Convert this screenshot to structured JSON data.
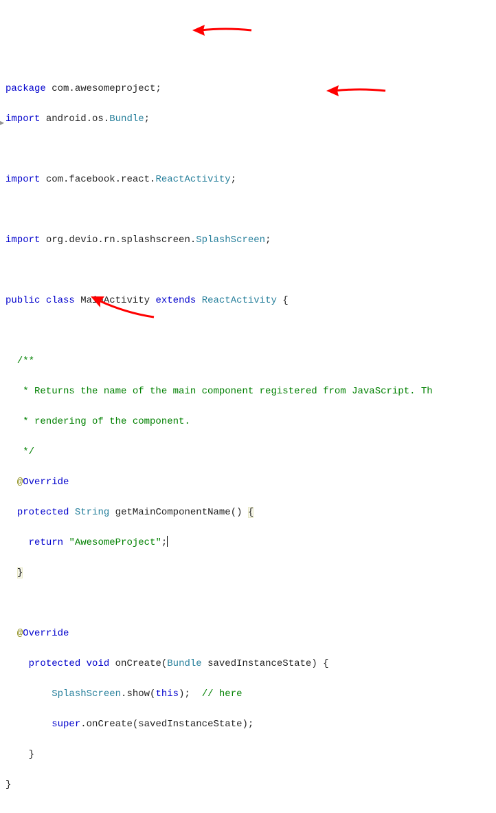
{
  "code": {
    "pkg_kw": "package",
    "pkg_val": " com.awesomeproject;",
    "imp1_kw": "import",
    "imp1_val": " android.os.",
    "imp1_type": "Bundle",
    "imp1_end": ";",
    "imp2_kw": "import",
    "imp2_val": " com.facebook.react.",
    "imp2_type": "ReactActivity",
    "imp2_end": ";",
    "imp3_kw": "import",
    "imp3_val": " org.devio.rn.splashscreen.",
    "imp3_type": "SplashScreen",
    "imp3_end": ";",
    "cls_public": "public",
    "cls_class": "class",
    "cls_name": " MainActivity ",
    "cls_extends": "extends",
    "cls_super": "ReactActivity",
    "cls_open": " {",
    "doc1": "  /**",
    "doc2": "   * Returns the name of the main component registered from JavaScript. Th",
    "doc3": "   * rendering of the component.",
    "doc4": "   */",
    "ovr1_at": "@",
    "ovr1_txt": "Override",
    "m1_prot": "protected",
    "m1_ret": "String",
    "m1_name": " getMainComponentName() ",
    "m1_brace_open": "{",
    "m1_return": "return",
    "m1_str": "\"AwesomeProject\"",
    "m1_semi": ";",
    "m1_brace_close": "}",
    "ovr2_at": "@",
    "ovr2_txt": "Override",
    "m2_prot": "protected",
    "m2_void": "void",
    "m2_name": " onCreate(",
    "m2_param_type": "Bundle",
    "m2_param_name": " savedInstanceState) {",
    "m2_l1a": "SplashScreen",
    "m2_l1b": ".show(",
    "m2_l1c": "this",
    "m2_l1d": ");  ",
    "m2_l1e": "// here",
    "m2_l2a": "super",
    "m2_l2b": ".onCreate(savedInstanceState);",
    "m2_close": "    }",
    "cls_close": "}"
  }
}
